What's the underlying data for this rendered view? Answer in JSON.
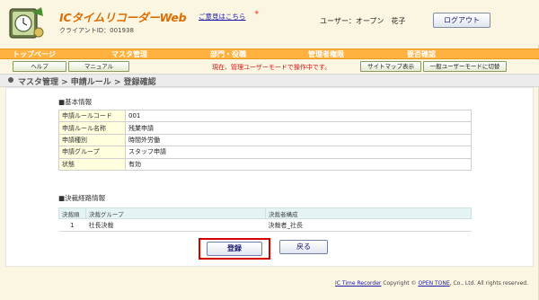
{
  "header": {
    "app_title": "ICタイムリコーダーWeb",
    "client_id": "クライアントID：001938",
    "feedback_link": "ご意見はこちら",
    "user_label": "ユーザー：オープン　花子",
    "logout_label": "ログアウト"
  },
  "nav": {
    "items": [
      "トップページ",
      "マスタ管理",
      "部門・役職",
      "管理者権限",
      "要否確認"
    ]
  },
  "subbar": {
    "help_label": "ヘルプ",
    "manual_label": "マニュアル",
    "mode_message": "現在、管理ユーザーモードで操作中です。",
    "sitemap_label": "サイトマップ表示",
    "general_mode_label": "一般ユーザーモードに切替"
  },
  "breadcrumb": "マスタ管理 > 申請ルール > 登録確認",
  "basic_info": {
    "title": "■基本情報",
    "rows": [
      {
        "label": "申請ルールコード",
        "value": "001"
      },
      {
        "label": "申請ルール名称",
        "value": "残業申請"
      },
      {
        "label": "申請種別",
        "value": "時間外労働"
      },
      {
        "label": "申請グループ",
        "value": "スタッフ申請"
      },
      {
        "label": "状態",
        "value": "有効"
      }
    ]
  },
  "route_info": {
    "title": "■決裁経路情報",
    "columns": [
      "決裁順",
      "決裁グループ",
      "決裁者構成"
    ],
    "rows": [
      {
        "order": "1",
        "group": "社長決裁",
        "approver": "決裁者_社長"
      }
    ]
  },
  "actions": {
    "submit_label": "登録",
    "back_label": "戻る"
  },
  "footer": {
    "product": "IC Time Recorder",
    "copyright_mid": " Copyright © ",
    "company": "OPEN TONE",
    "copyright_end": ", Co., Ltd. All rights reserved."
  },
  "colors": {
    "nav_bg": "#ffb23f",
    "title_orange": "#e06c00",
    "highlight_red": "#d40000",
    "label_bg": "#ffffdd"
  },
  "icons": {
    "logo": "hourglass-clock-logo",
    "feedback": "sparkle-icon",
    "breadcrumb": "bullet-icon"
  }
}
